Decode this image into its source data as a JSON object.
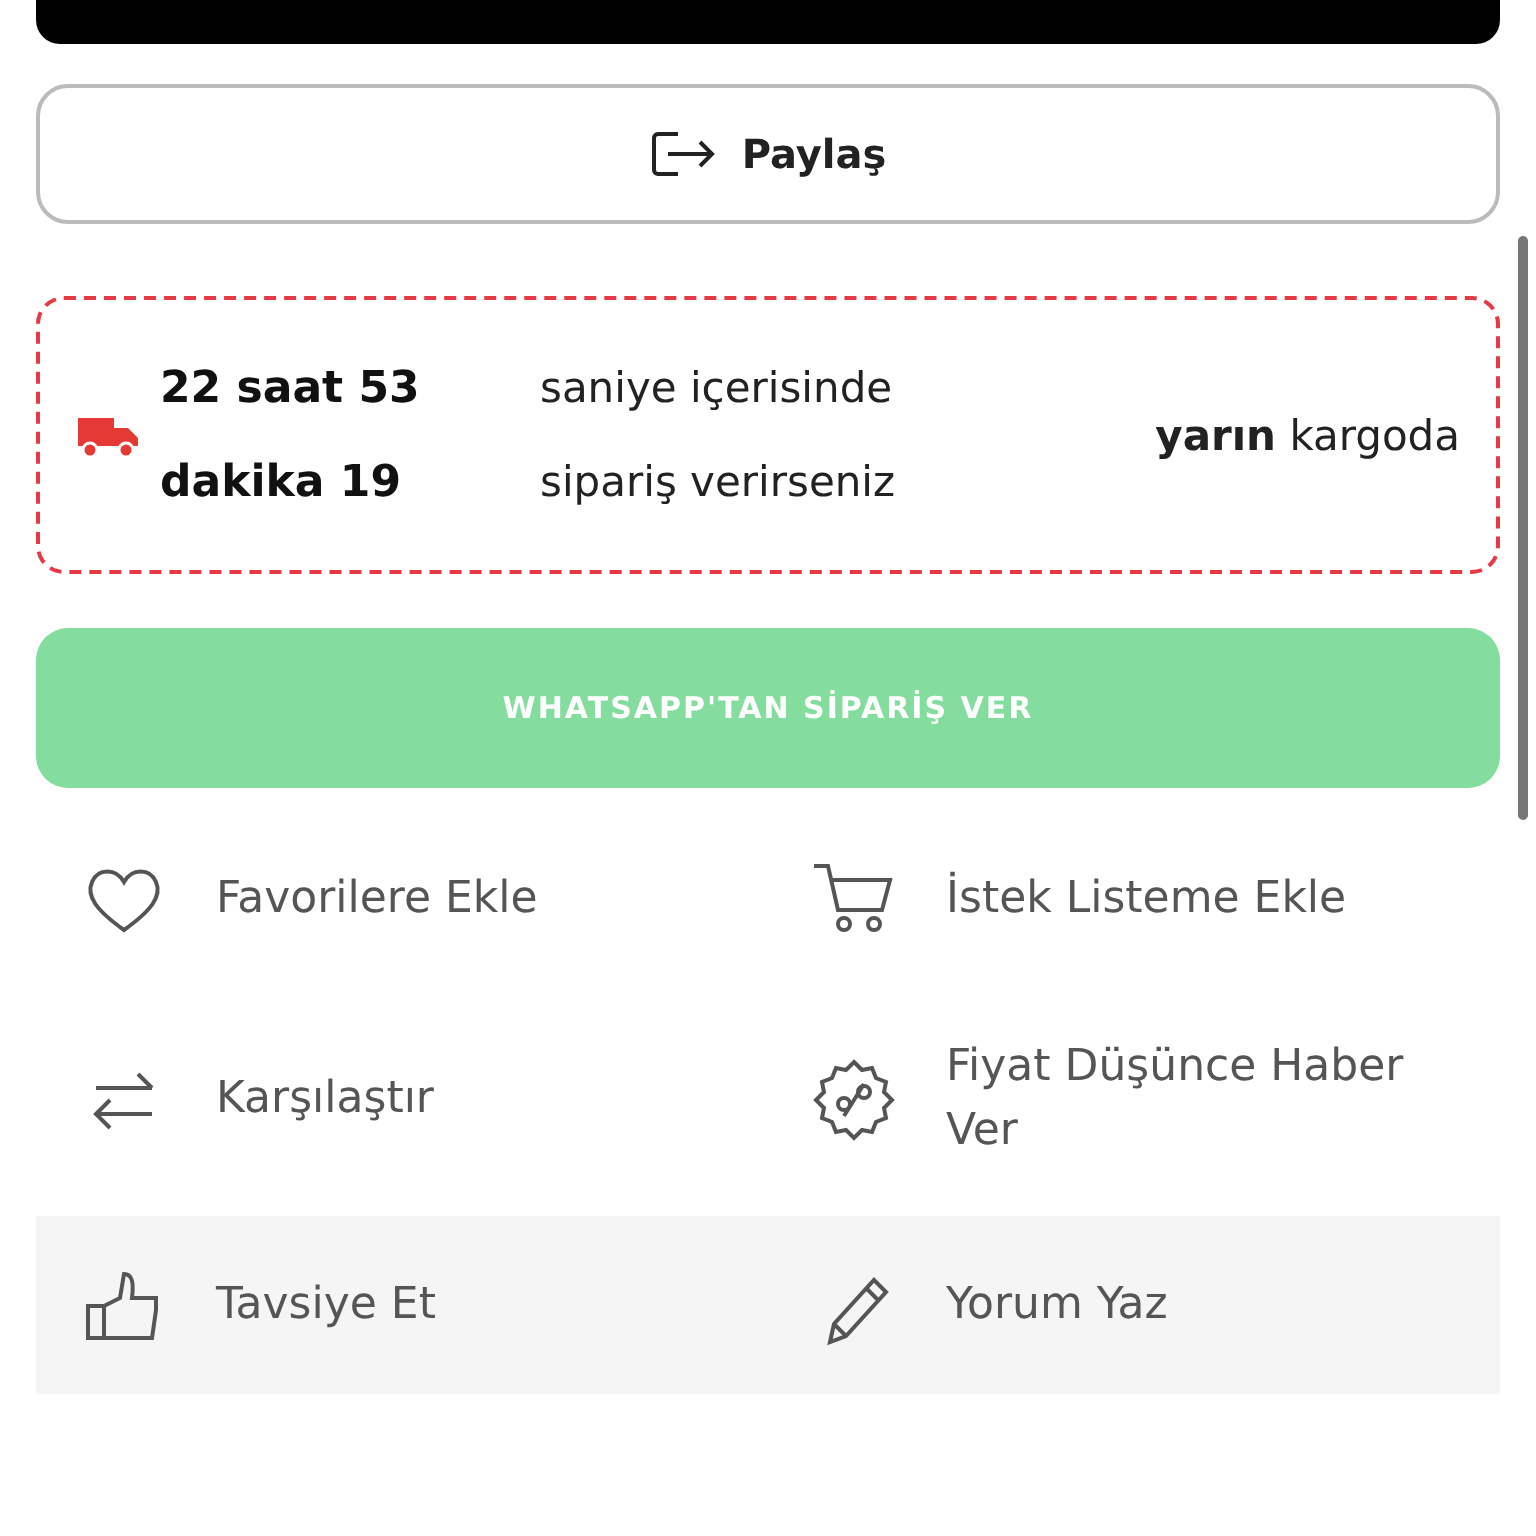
{
  "share_button": {
    "label": "Paylaş"
  },
  "shipping_notice": {
    "countdown_lines": [
      [
        "22 saat 53",
        "saniye içerisinde"
      ],
      [
        "dakika 19",
        "sipariş verirseniz"
      ]
    ],
    "delivery": "**yarın** kargoda"
  },
  "whatsapp_button": {
    "label": "WHATSAPP'TAN SİPARİŞ VER"
  },
  "action_rows": [
    {
      "highlighted": false,
      "items": [
        {
          "kind": "heart",
          "label": "Favorilere Ekle"
        },
        {
          "kind": "cart",
          "label": "İstek Listeme Ekle"
        }
      ]
    },
    {
      "highlighted": false,
      "items": [
        {
          "kind": "compare",
          "label": "Karşılaştır"
        },
        {
          "kind": "discount",
          "label": "Fiyat Düşünce Haber Ver"
        }
      ]
    },
    {
      "highlighted": true,
      "items": [
        {
          "kind": "thumb",
          "label": "Tavsiye Et"
        },
        {
          "kind": "pencil",
          "label": "Yorum Yaz"
        }
      ]
    }
  ]
}
